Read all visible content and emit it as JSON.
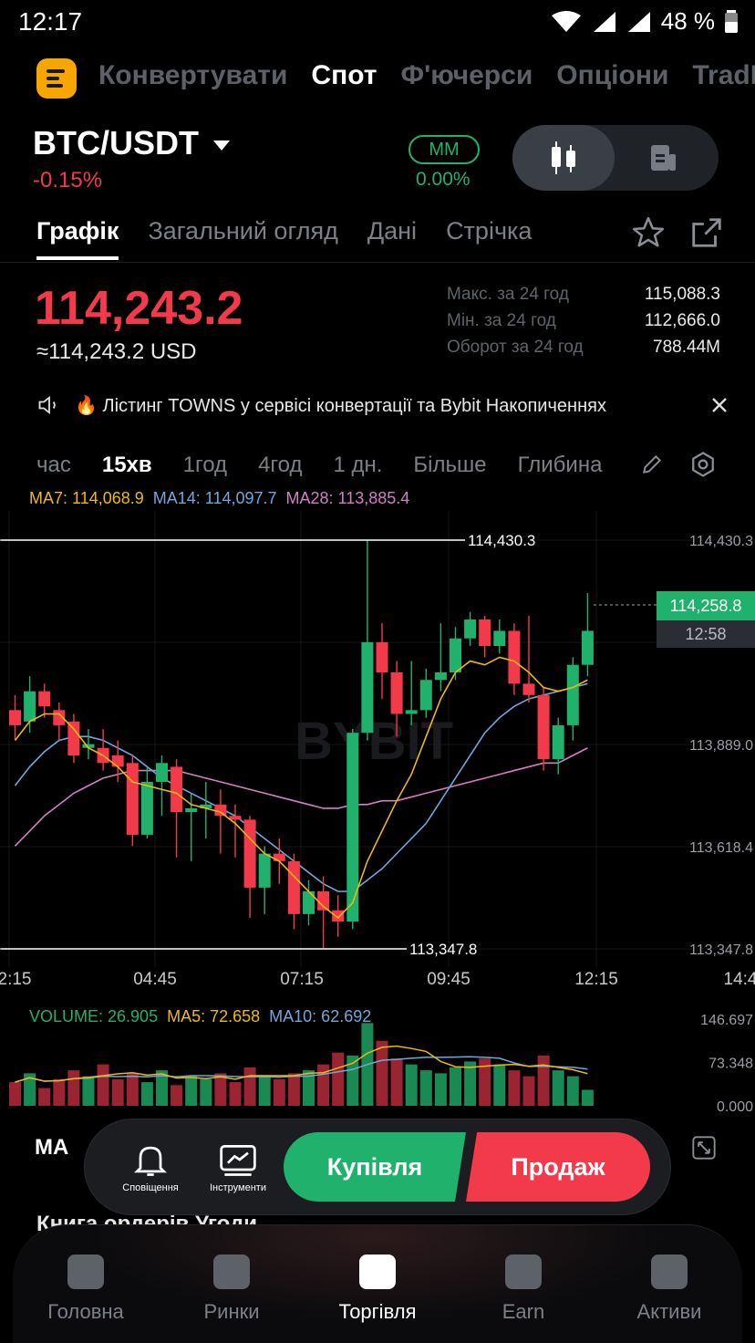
{
  "status_bar": {
    "time": "12:17",
    "battery": "48 %"
  },
  "top_nav": {
    "tabs": [
      "Конвертувати",
      "Спот",
      "Ф'ючерси",
      "Опціони",
      "TradFi"
    ],
    "active_index": 1
  },
  "pair": {
    "symbol": "BTC/USDT",
    "change": "-0.15%",
    "mm_label": "MM",
    "mm_value": "0.00%"
  },
  "sub_tabs": {
    "items": [
      "Графік",
      "Загальний огляд",
      "Дані",
      "Стрічка"
    ],
    "active_index": 0
  },
  "price": {
    "last": "114,243.2",
    "usd": "≈114,243.2 USD"
  },
  "stats": [
    {
      "label": "Макс. за 24 год",
      "value": "115,088.3"
    },
    {
      "label": "Мін. за 24 год",
      "value": "112,666.0"
    },
    {
      "label": "Оборот за 24 год",
      "value": "788.44M"
    }
  ],
  "notice": {
    "text": "🔥 Лістинг TOWNS у сервісі конвертації та Bybit Накопиченнях"
  },
  "timeframes": {
    "items": [
      "час",
      "15хв",
      "1год",
      "4год",
      "1 дн.",
      "Більше",
      "Глибина"
    ],
    "active_index": 1
  },
  "ma_legend": [
    {
      "label": "MA7: 114,068.9",
      "color": "#f0b90b"
    },
    {
      "label": "MA14: 114,097.7",
      "color": "#6fa8dc"
    },
    {
      "label": "MA28: 113,885.4",
      "color": "#d37fc2"
    }
  ],
  "chart": {
    "y_ticks": [
      "114,430.3",
      "113,889.0",
      "113,618.4",
      "113,347.8"
    ],
    "x_ticks": [
      "2:15",
      "04:45",
      "07:15",
      "09:45",
      "12:15",
      "14:4"
    ],
    "high_label": "114,430.3",
    "low_label": "113,347.8",
    "current_price": "114,258.8",
    "countdown": "12:58",
    "watermark": "BYBIT"
  },
  "volume_legend": [
    {
      "label": "VOLUME: 26.905",
      "color": "#20b26c"
    },
    {
      "label": "MA5: 72.658",
      "color": "#f0b90b"
    },
    {
      "label": "MA10: 62.692",
      "color": "#6fa8dc"
    }
  ],
  "volume_axis": [
    "146.697",
    "73.348",
    "0.000"
  ],
  "bottom_actions": {
    "ma": "MA",
    "alerts": "Сповіщення",
    "tools": "Інструменти",
    "buy": "Купівля",
    "sell": "Продаж",
    "peek": "Книга ордерів    Угоди"
  },
  "bottom_nav": {
    "items": [
      "Головна",
      "Ринки",
      "Торгівля",
      "Earn",
      "Активи"
    ],
    "active_index": 2
  },
  "colors": {
    "up": "#20b26c",
    "down": "#f23a4b",
    "accent": "#f7a600"
  },
  "chart_data": {
    "type": "candlestick",
    "interval": "15хв",
    "y_range": [
      113347.8,
      114430.3
    ],
    "candles": [
      {
        "o": 113980,
        "c": 113940,
        "h": 114020,
        "l": 113900
      },
      {
        "o": 113950,
        "c": 114030,
        "h": 114070,
        "l": 113920
      },
      {
        "o": 114030,
        "c": 113990,
        "h": 114050,
        "l": 113960
      },
      {
        "o": 113980,
        "c": 113940,
        "h": 114000,
        "l": 113900
      },
      {
        "o": 113950,
        "c": 113860,
        "h": 113970,
        "l": 113840
      },
      {
        "o": 113880,
        "c": 113890,
        "h": 113930,
        "l": 113850
      },
      {
        "o": 113880,
        "c": 113840,
        "h": 113930,
        "l": 113820
      },
      {
        "o": 113860,
        "c": 113830,
        "h": 113900,
        "l": 113790
      },
      {
        "o": 113840,
        "c": 113650,
        "h": 113860,
        "l": 113620
      },
      {
        "o": 113650,
        "c": 113790,
        "h": 113830,
        "l": 113640
      },
      {
        "o": 113790,
        "c": 113840,
        "h": 113860,
        "l": 113700
      },
      {
        "o": 113830,
        "c": 113710,
        "h": 113850,
        "l": 113590
      },
      {
        "o": 113710,
        "c": 113720,
        "h": 113760,
        "l": 113580
      },
      {
        "o": 113720,
        "c": 113730,
        "h": 113790,
        "l": 113640
      },
      {
        "o": 113730,
        "c": 113700,
        "h": 113770,
        "l": 113600
      },
      {
        "o": 113700,
        "c": 113690,
        "h": 113730,
        "l": 113590
      },
      {
        "o": 113690,
        "c": 113510,
        "h": 113700,
        "l": 113430
      },
      {
        "o": 113510,
        "c": 113600,
        "h": 113620,
        "l": 113440
      },
      {
        "o": 113600,
        "c": 113580,
        "h": 113640,
        "l": 113520
      },
      {
        "o": 113580,
        "c": 113440,
        "h": 113600,
        "l": 113400
      },
      {
        "o": 113440,
        "c": 113500,
        "h": 113530,
        "l": 113410
      },
      {
        "o": 113500,
        "c": 113450,
        "h": 113540,
        "l": 113350
      },
      {
        "o": 113450,
        "c": 113420,
        "h": 113490,
        "l": 113380
      },
      {
        "o": 113420,
        "c": 113920,
        "h": 113930,
        "l": 113400
      },
      {
        "o": 113920,
        "c": 114160,
        "h": 114430,
        "l": 113900
      },
      {
        "o": 114160,
        "c": 114080,
        "h": 114210,
        "l": 114010
      },
      {
        "o": 114080,
        "c": 113970,
        "h": 114110,
        "l": 113910
      },
      {
        "o": 113970,
        "c": 113980,
        "h": 114110,
        "l": 113940
      },
      {
        "o": 113980,
        "c": 114060,
        "h": 114090,
        "l": 113960
      },
      {
        "o": 114060,
        "c": 114080,
        "h": 114210,
        "l": 114030
      },
      {
        "o": 114080,
        "c": 114170,
        "h": 114200,
        "l": 114060
      },
      {
        "o": 114170,
        "c": 114220,
        "h": 114240,
        "l": 114150
      },
      {
        "o": 114220,
        "c": 114150,
        "h": 114230,
        "l": 114120
      },
      {
        "o": 114150,
        "c": 114190,
        "h": 114220,
        "l": 114130
      },
      {
        "o": 114190,
        "c": 114050,
        "h": 114210,
        "l": 114020
      },
      {
        "o": 114050,
        "c": 114020,
        "h": 114230,
        "l": 114000
      },
      {
        "o": 114020,
        "c": 113850,
        "h": 114040,
        "l": 113820
      },
      {
        "o": 113850,
        "c": 113940,
        "h": 113960,
        "l": 113810
      },
      {
        "o": 113940,
        "c": 114100,
        "h": 114120,
        "l": 113900
      },
      {
        "o": 114100,
        "c": 114190,
        "h": 114290,
        "l": 114070
      }
    ],
    "ma7": [
      113900,
      113950,
      113970,
      113970,
      113930,
      113880,
      113860,
      113830,
      113790,
      113780,
      113770,
      113760,
      113730,
      113720,
      113710,
      113680,
      113640,
      113600,
      113580,
      113540,
      113500,
      113460,
      113430,
      113470,
      113580,
      113660,
      113740,
      113810,
      113910,
      114010,
      114080,
      114110,
      114100,
      114120,
      114110,
      114080,
      114040,
      114030,
      114040,
      114060
    ],
    "ma14": [
      113780,
      113830,
      113870,
      113900,
      113910,
      113910,
      113900,
      113880,
      113860,
      113830,
      113800,
      113780,
      113760,
      113740,
      113720,
      113700,
      113670,
      113640,
      113610,
      113580,
      113550,
      113520,
      113500,
      113500,
      113530,
      113560,
      113600,
      113640,
      113680,
      113740,
      113800,
      113860,
      113920,
      113960,
      113990,
      114010,
      114020,
      114030,
      114040,
      114050
    ],
    "ma28": [
      113620,
      113660,
      113700,
      113730,
      113760,
      113780,
      113800,
      113810,
      113820,
      113820,
      113820,
      113820,
      113810,
      113800,
      113790,
      113780,
      113770,
      113760,
      113750,
      113740,
      113730,
      113720,
      113720,
      113730,
      113730,
      113740,
      113740,
      113750,
      113760,
      113770,
      113780,
      113790,
      113800,
      113810,
      113820,
      113830,
      113840,
      113840,
      113860,
      113880
    ],
    "volume": [
      40,
      55,
      30,
      45,
      60,
      50,
      70,
      45,
      55,
      40,
      60,
      35,
      50,
      45,
      55,
      40,
      65,
      50,
      45,
      55,
      60,
      70,
      90,
      85,
      140,
      110,
      80,
      70,
      60,
      55,
      65,
      75,
      80,
      70,
      60,
      50,
      85,
      60,
      50,
      27
    ]
  }
}
